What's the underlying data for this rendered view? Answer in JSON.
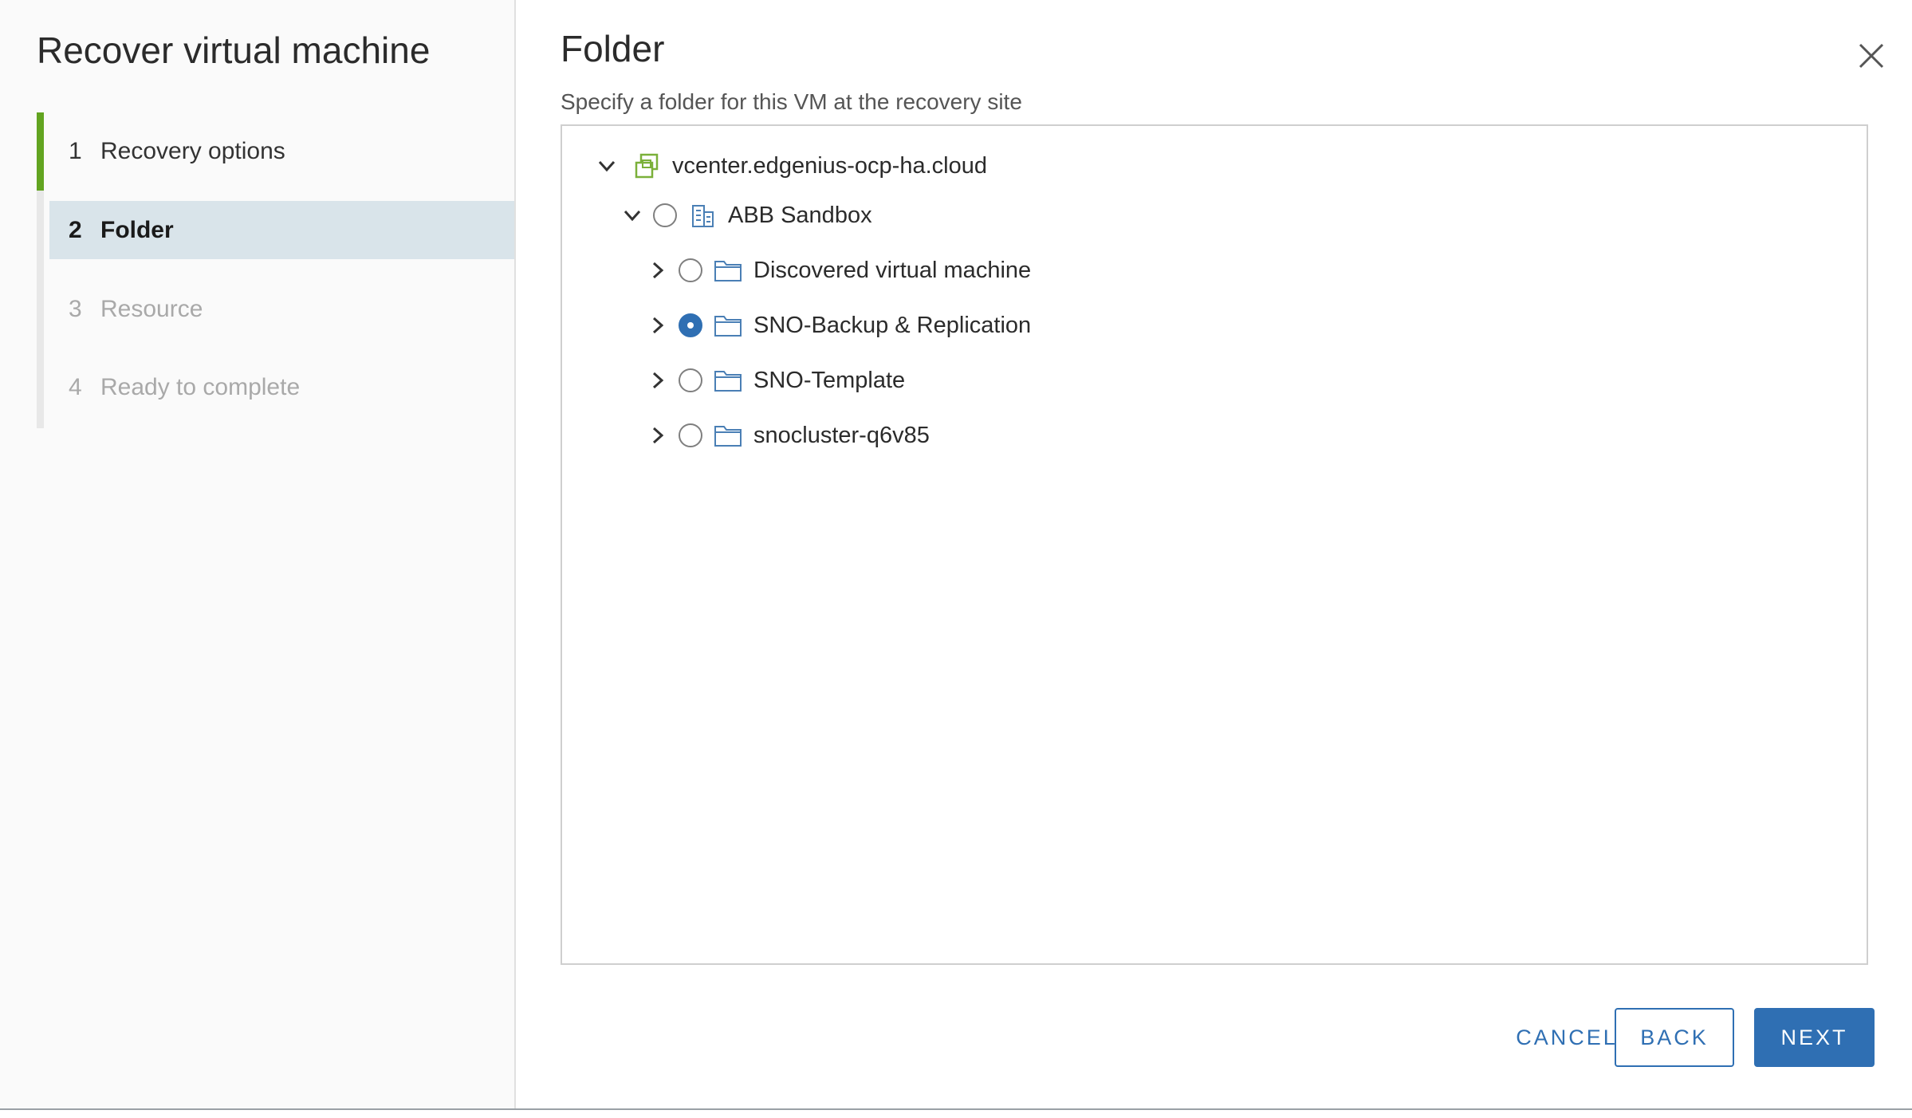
{
  "wizard": {
    "title": "Recover virtual machine",
    "steps": [
      {
        "num": "1",
        "label": "Recovery options",
        "state": "completed"
      },
      {
        "num": "2",
        "label": "Folder",
        "state": "active"
      },
      {
        "num": "3",
        "label": "Resource",
        "state": "disabled"
      },
      {
        "num": "4",
        "label": "Ready to complete",
        "state": "disabled"
      }
    ]
  },
  "page": {
    "title": "Folder",
    "subtitle": "Specify a folder for this VM at the recovery site"
  },
  "tree": {
    "root": {
      "label": "vcenter.edgenius-ocp-ha.cloud",
      "icon": "vcenter-icon",
      "expanded": true
    },
    "datacenter": {
      "label": "ABB Sandbox",
      "icon": "datacenter-icon",
      "expanded": true,
      "selected": false
    },
    "folders": [
      {
        "label": "Discovered virtual machine",
        "icon": "folder-icon",
        "selected": false
      },
      {
        "label": "SNO-Backup & Replication",
        "icon": "folder-icon",
        "selected": true
      },
      {
        "label": "SNO-Template",
        "icon": "folder-icon",
        "selected": false
      },
      {
        "label": "snocluster-q6v85",
        "icon": "folder-icon",
        "selected": false
      }
    ]
  },
  "buttons": {
    "cancel": "CANCEL",
    "back": "BACK",
    "next": "NEXT"
  },
  "colors": {
    "accent": "#2f6fb3",
    "progress": "#62a420",
    "active_step_bg": "#d9e4ea",
    "vcenter_icon": "#7bb03a"
  }
}
